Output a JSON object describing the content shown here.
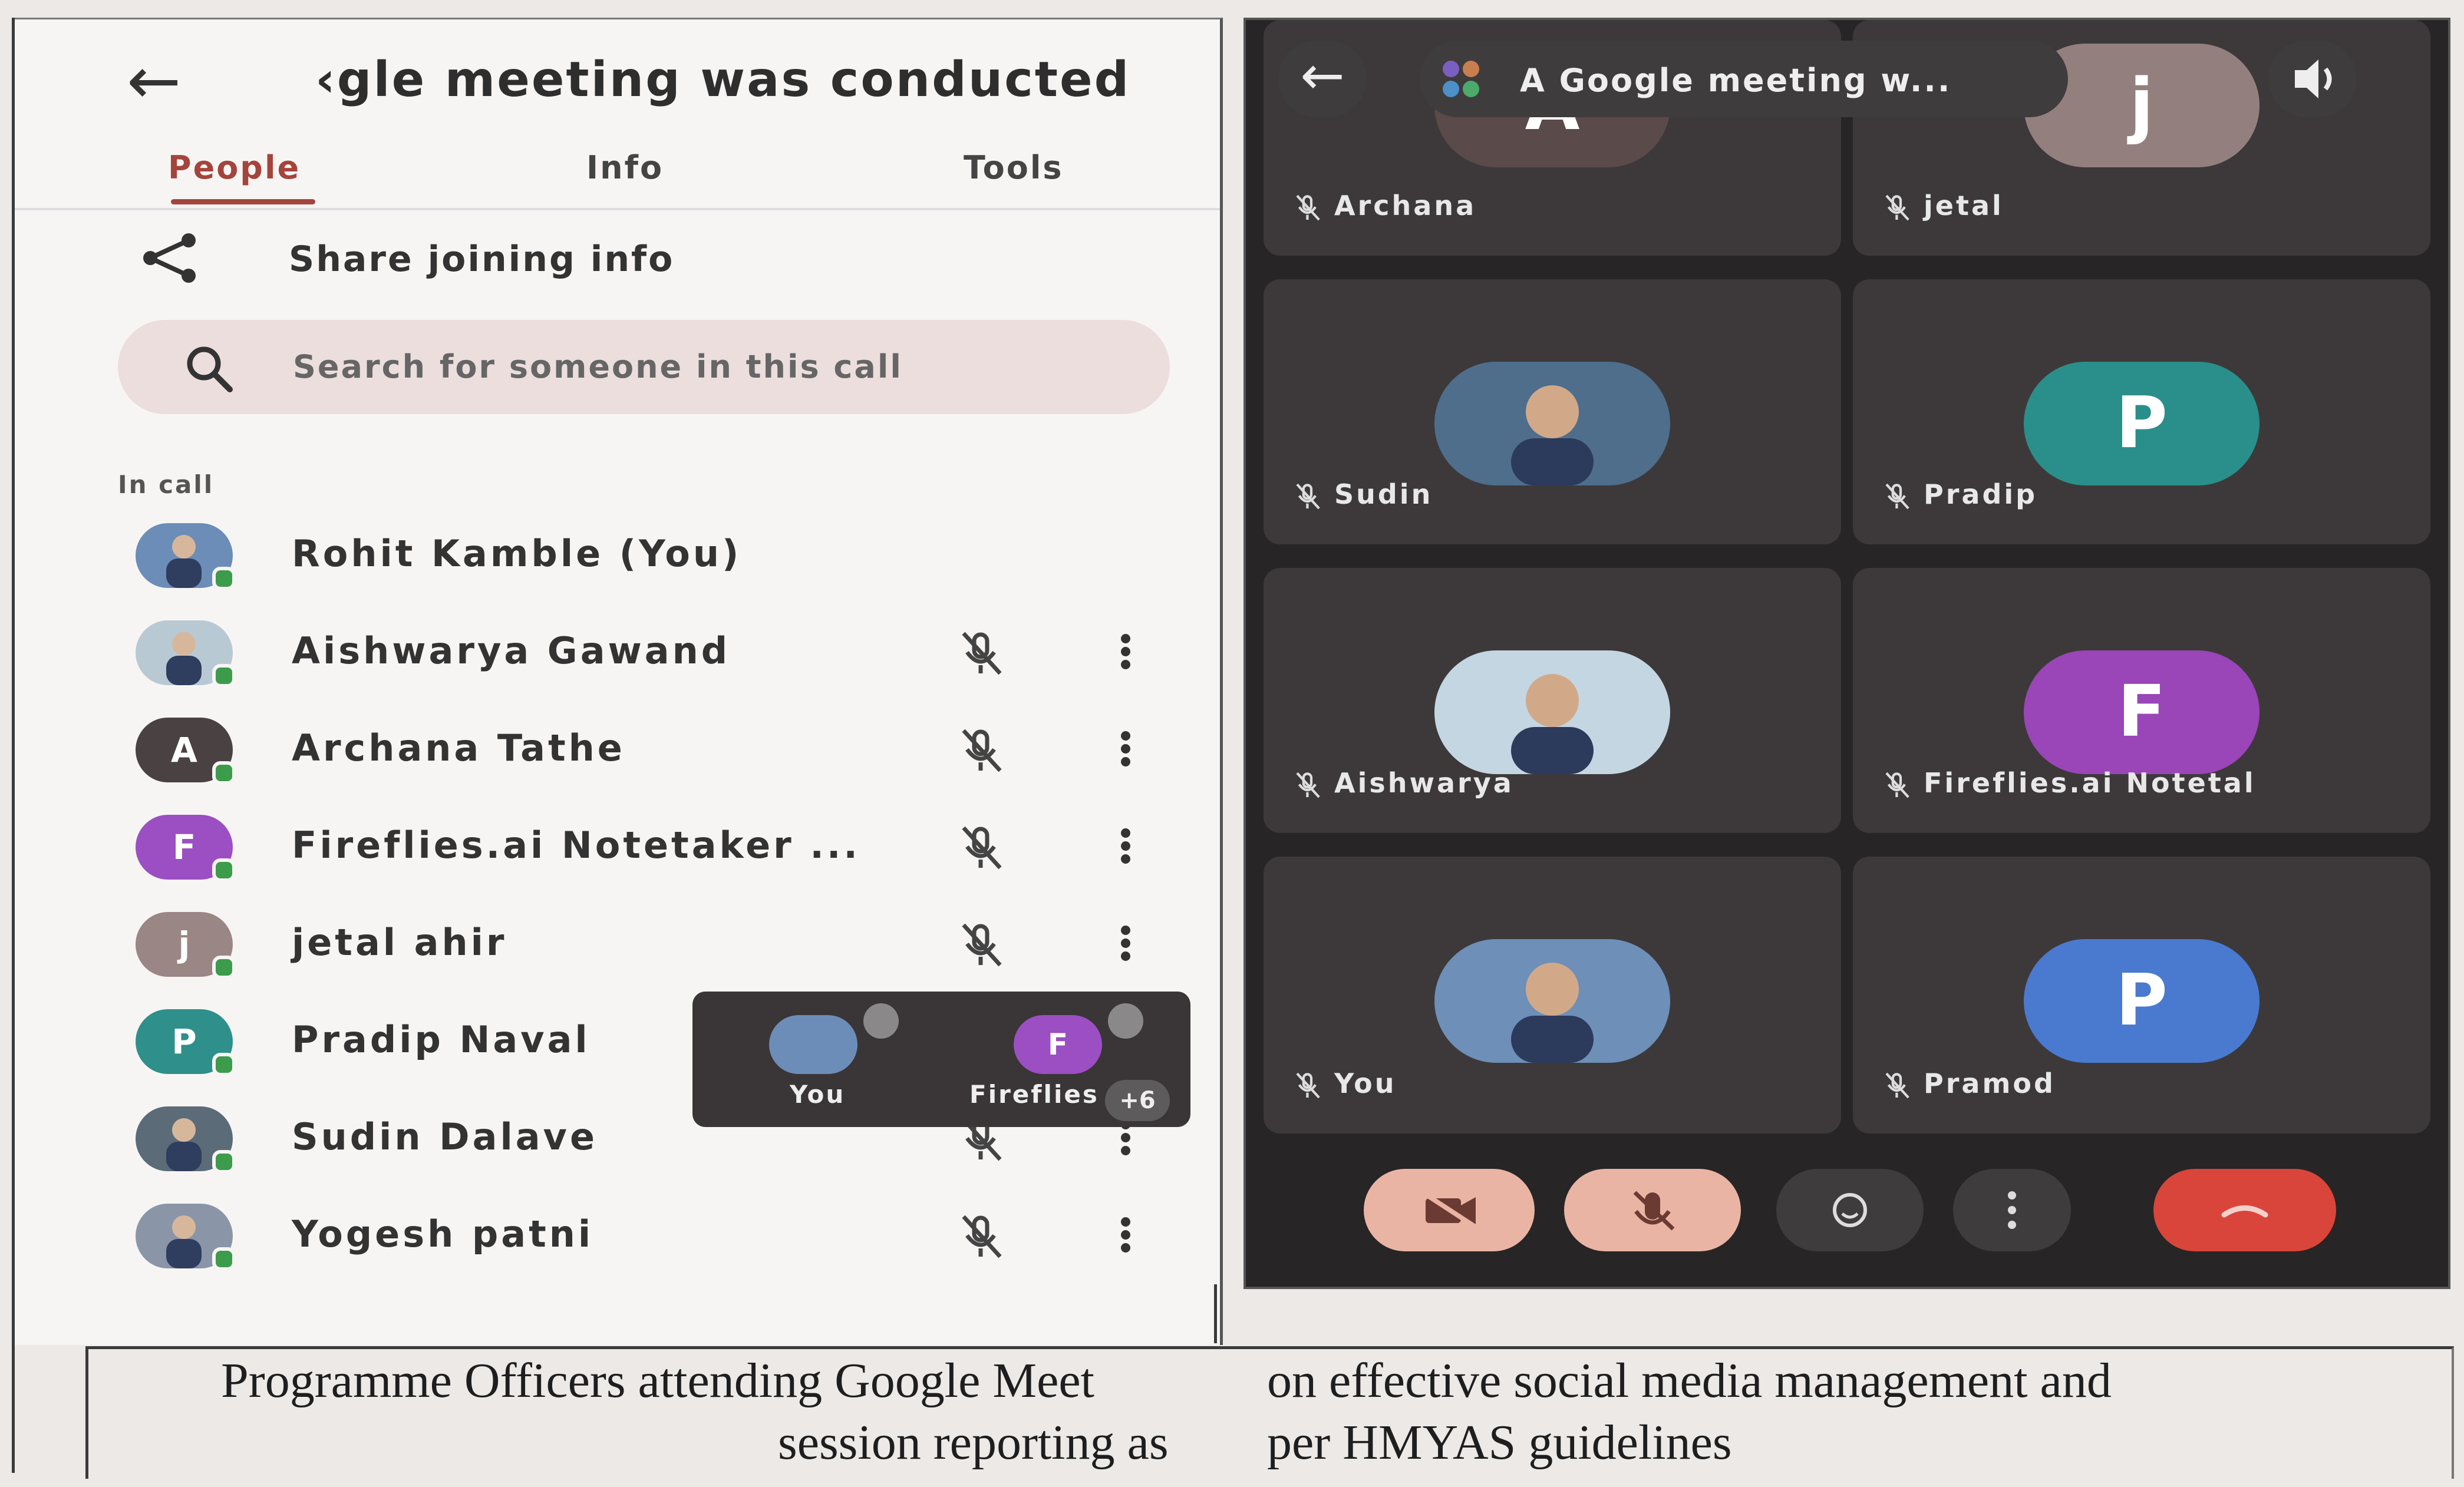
{
  "left_panel": {
    "back_icon": "arrow-left",
    "meeting_title": "‹gle meeting was conducted",
    "tabs": [
      "People",
      "Info",
      "Tools"
    ],
    "active_tab": "People",
    "accent_color": "#a4443c",
    "share_label": "Share joining info",
    "search_placeholder": "Search for someone in this call",
    "section_label": "In call",
    "people": [
      {
        "name": "Rohit Kamble (You)",
        "avatar": "photo",
        "initial": "",
        "color": "#6c8db7",
        "muted": false,
        "has_menu": false
      },
      {
        "name": "Aishwarya Gawand",
        "avatar": "photo",
        "initial": "",
        "color": "#b9c9d4",
        "muted": true,
        "has_menu": true
      },
      {
        "name": "Archana Tathe",
        "avatar": "initial",
        "initial": "A",
        "color": "#4a4242",
        "muted": true,
        "has_menu": true
      },
      {
        "name": "Fireflies.ai Notetaker ...",
        "avatar": "initial",
        "initial": "F",
        "color": "#9b4fc3",
        "muted": true,
        "has_menu": true
      },
      {
        "name": "jetal ahir",
        "avatar": "initial",
        "initial": "j",
        "color": "#9a8684",
        "muted": true,
        "has_menu": true
      },
      {
        "name": "Pradip Naval",
        "avatar": "initial",
        "initial": "P",
        "color": "#2f8f8a",
        "muted": false,
        "has_menu": false
      },
      {
        "name": "Sudin Dalave",
        "avatar": "photo",
        "initial": "",
        "color": "#5b6b78",
        "muted": true,
        "has_menu": true
      },
      {
        "name": "Yogesh patni",
        "avatar": "photo",
        "initial": "",
        "color": "#8a96a8",
        "muted": true,
        "has_menu": true
      }
    ],
    "pip": {
      "tiles": [
        {
          "label": "You",
          "avatar": "photo",
          "initial": "",
          "color": "#6c8db7"
        },
        {
          "label": "Fireflies",
          "avatar": "initial",
          "initial": "F",
          "color": "#9b4fc3"
        }
      ],
      "more_count": "+6"
    }
  },
  "right_panel": {
    "title": "A Google meeting w...",
    "back_icon": "arrow-left",
    "speaker_icon": "speaker",
    "tiles": [
      {
        "name": "Archana",
        "avatar": "initial",
        "initial": "A",
        "color": "#5a4a49"
      },
      {
        "name": "jetal",
        "avatar": "initial",
        "initial": "j",
        "color": "#93807e"
      },
      {
        "name": "Sudin",
        "avatar": "photo",
        "initial": "",
        "color": "#4e6e8c"
      },
      {
        "name": "Pradip",
        "avatar": "initial",
        "initial": "P",
        "color": "#2a8f8a"
      },
      {
        "name": "Aishwarya",
        "avatar": "photo",
        "initial": "",
        "color": "#c4d6e2"
      },
      {
        "name": "Fireflies.ai Notetal",
        "avatar": "initial",
        "initial": "F",
        "color": "#9a45b8"
      },
      {
        "name": "You",
        "avatar": "photo",
        "initial": "",
        "color": "#6d8fb8"
      },
      {
        "name": "Pramod",
        "avatar": "initial",
        "initial": "P",
        "color": "#4a7ad0"
      }
    ],
    "controls": [
      {
        "name": "camera-off-button",
        "color": "#eab4a4"
      },
      {
        "name": "mic-off-button",
        "color": "#eab4a4"
      },
      {
        "name": "reactions-button",
        "color": "#3f3c3d"
      },
      {
        "name": "more-options-button",
        "color": "#3f3c3d"
      },
      {
        "name": "end-call-button",
        "color": "#d9453a"
      }
    ]
  },
  "caption": {
    "line1_left": "Programme Officers attending Google Meet",
    "line2_left": "session reporting as",
    "line1_right": "on effective social media management and",
    "line2_right": "per HMYAS guidelines"
  }
}
